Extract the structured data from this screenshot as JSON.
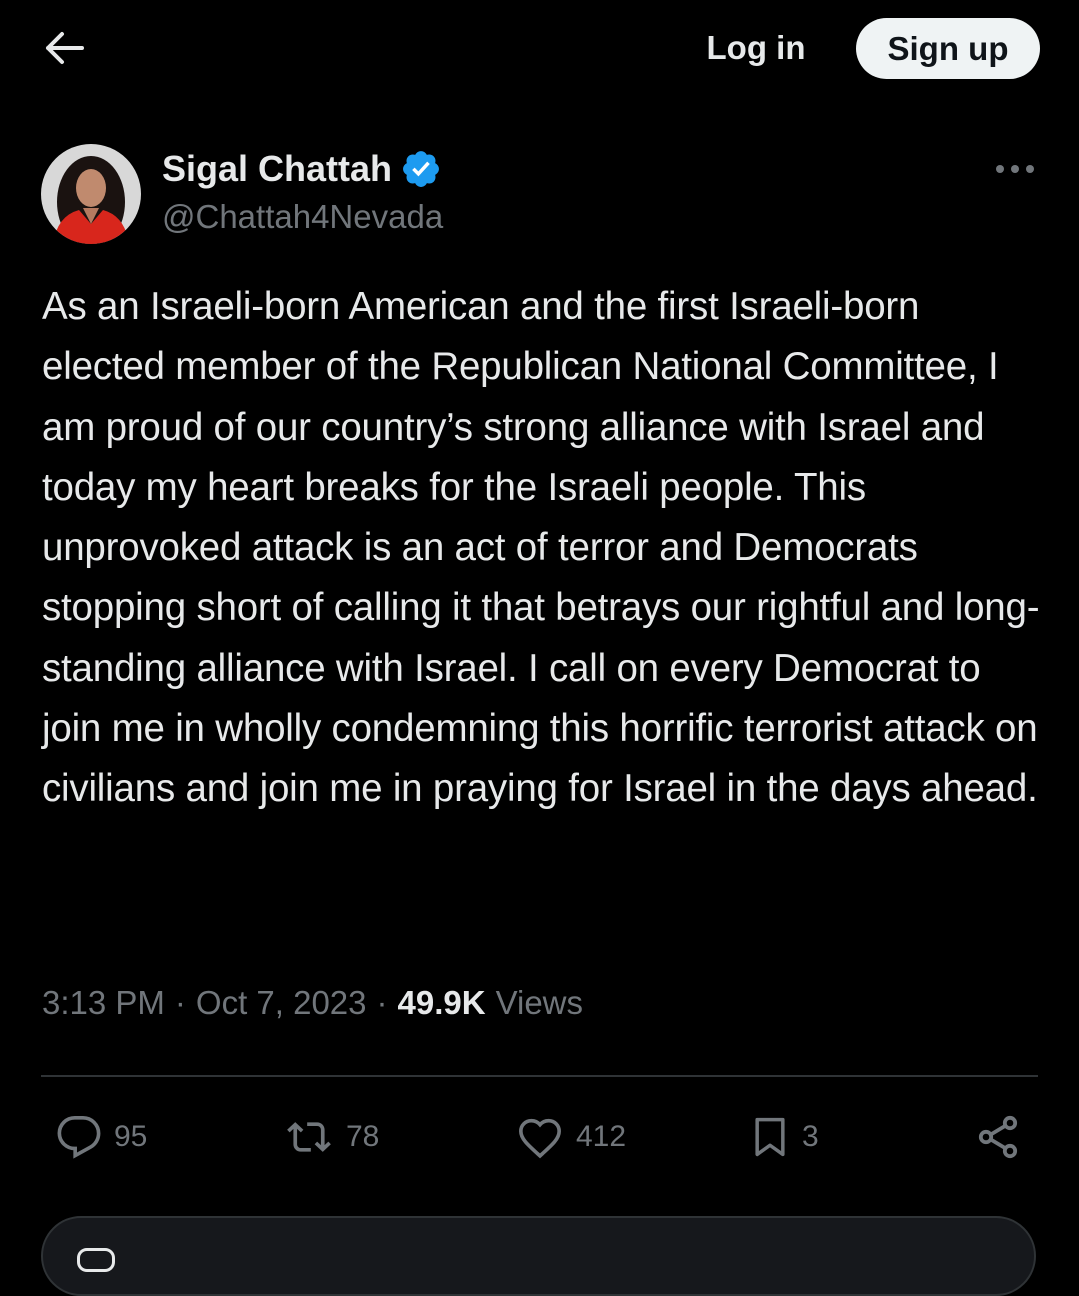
{
  "header": {
    "back_icon": "arrow-left-icon",
    "login_label": "Log in",
    "signup_label": "Sign up"
  },
  "tweet": {
    "author_name": "Sigal Chattah",
    "author_handle": "@Chattah4Nevada",
    "verified_icon": "verified-badge-icon",
    "verified_color": "#1d9bf0",
    "more_icon": "more-dots-icon",
    "text": "As an Israeli-born American and the first Israeli-born elected member of the Republican National Committee, I am proud of our country’s strong alliance with Israel and today my heart breaks for the Israeli people. This unprovoked attack is an act of terror and Democrats stopping short of calling it that betrays our rightful and long-standing alliance with Israel. I call on every Democrat to join me in wholly condemning this horrific terrorist attack on civilians and join me in praying for Israel in the days ahead.",
    "time": "3:13 PM",
    "date": "Oct 7, 2023",
    "separator": "·",
    "views_count": "49.9K",
    "views_label": "Views"
  },
  "actions": {
    "reply": {
      "icon": "reply-bubble-icon",
      "count": "95"
    },
    "retweet": {
      "icon": "retweet-icon",
      "count": "78"
    },
    "like": {
      "icon": "heart-icon",
      "count": "412"
    },
    "bookmark": {
      "icon": "bookmark-icon",
      "count": "3"
    },
    "share": {
      "icon": "share-icon"
    }
  },
  "colors": {
    "background": "#000000",
    "text_primary": "#e7e9ea",
    "text_secondary": "#71767b",
    "divider": "#2f3336",
    "signup_bg": "#eff3f4"
  }
}
